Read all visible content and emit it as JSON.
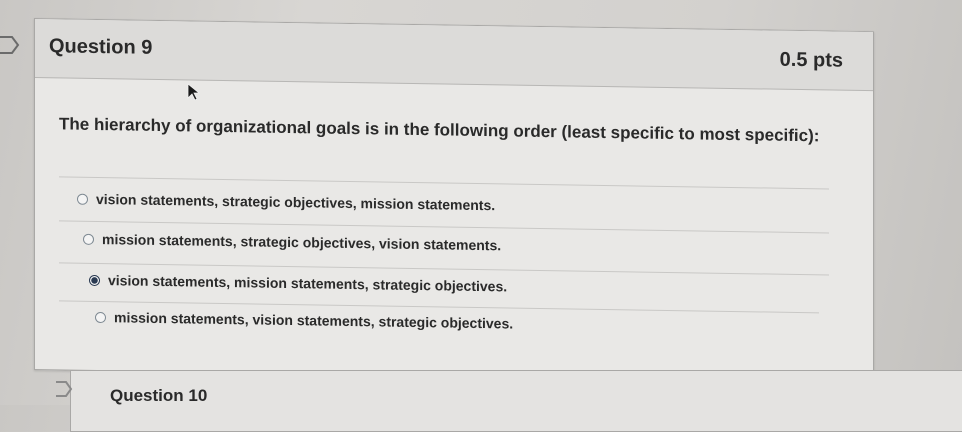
{
  "question": {
    "title": "Question 9",
    "points": "0.5 pts",
    "prompt": "The hierarchy of organizational goals is in the following order (least specific to most specific):",
    "answers": [
      {
        "label": "vision statements, strategic objectives, mission statements.",
        "selected": false
      },
      {
        "label": "mission statements, strategic objectives, vision statements.",
        "selected": false
      },
      {
        "label": "vision statements, mission statements, strategic objectives.",
        "selected": true
      },
      {
        "label": "mission statements, vision statements, strategic objectives.",
        "selected": false
      }
    ]
  },
  "next_question": {
    "title": "Question 10"
  }
}
